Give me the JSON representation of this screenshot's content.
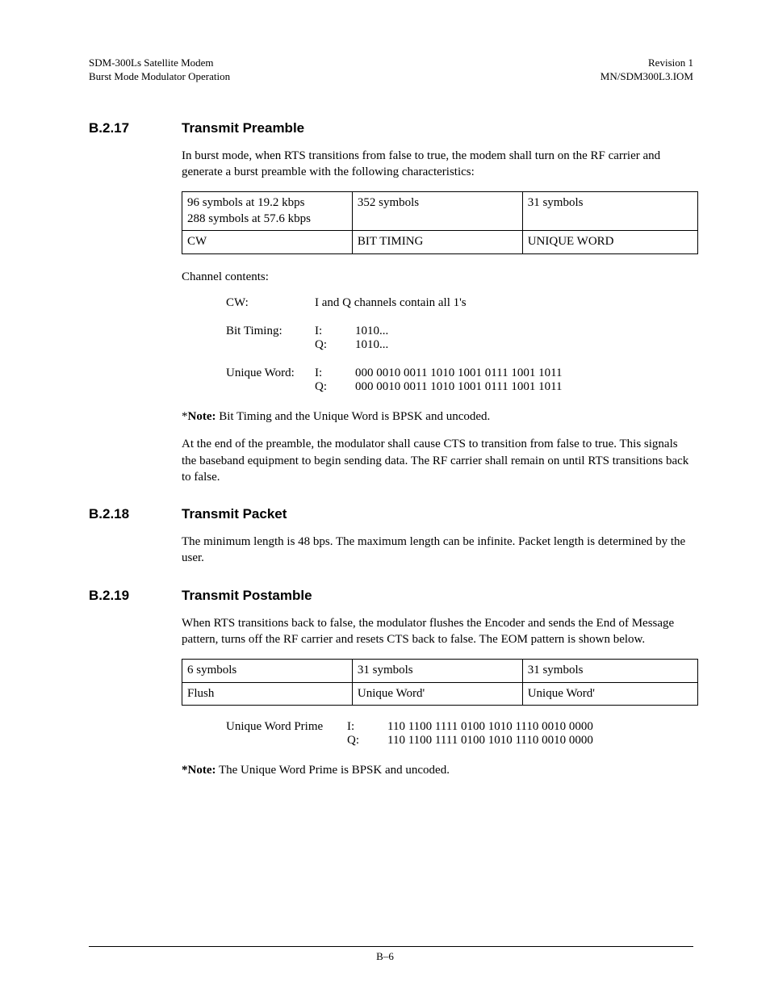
{
  "header": {
    "left": "SDM-300Ls Satellite Modem\nBurst Mode Modulator Operation",
    "right": "Revision 1\nMN/SDM300L3.IOM"
  },
  "s17": {
    "num": "B.2.17",
    "title": "Transmit Preamble",
    "intro": "In burst mode, when RTS transitions from false to true, the modem shall turn on the RF carrier and generate a burst preamble with the following characteristics:",
    "table": {
      "r1c1": "96 symbols at 19.2 kbps\n288 symbols at 57.6 kbps",
      "r1c2": "352 symbols",
      "r1c3": "31 symbols",
      "r2c1": "CW",
      "r2c2": "BIT TIMING",
      "r2c3": "UNIQUE WORD"
    },
    "chcontents_label": "Channel contents:",
    "cw": {
      "label": "CW:",
      "val": "I and Q channels contain all 1's"
    },
    "bt": {
      "label": "Bit Timing:",
      "i_lbl": "I:",
      "q_lbl": "Q:",
      "i_val": "1010...",
      "q_val": "1010..."
    },
    "uw": {
      "label": "Unique Word:",
      "i_lbl": "I:",
      "q_lbl": "Q:",
      "i_val": "000 0010 0011 1010 1001 0111 1001 1011",
      "q_val": "000 0010 0011 1010 1001 0111 1001 1011"
    },
    "note_prefix": "*",
    "note_bold": "Note:",
    "note_text": " Bit Timing and the Unique Word is BPSK and uncoded.",
    "outro": "At the end of the preamble, the modulator shall cause CTS to transition from false to true. This signals the baseband equipment to begin sending data. The RF carrier shall remain on until RTS transitions back to false."
  },
  "s18": {
    "num": "B.2.18",
    "title": "Transmit Packet",
    "body": "The minimum length is 48 bps. The maximum length can be infinite. Packet length is determined by the user."
  },
  "s19": {
    "num": "B.2.19",
    "title": "Transmit Postamble",
    "intro": "When RTS transitions back to false, the modulator flushes the Encoder and sends the End of Message pattern, turns off the RF carrier and resets CTS back to false. The EOM pattern is shown below.",
    "table": {
      "r1c1": "6 symbols",
      "r1c2": "31 symbols",
      "r1c3": "31 symbols",
      "r2c1": "Flush",
      "r2c2": "Unique Word'",
      "r2c3": "Unique Word'"
    },
    "uwp": {
      "label": "Unique Word Prime",
      "i_lbl": "I:",
      "q_lbl": "Q:",
      "i_val": "110 1100 1111 0100 1010 1110 0010 0000",
      "q_val": "110 1100 1111 0100 1010 1110 0010 0000"
    },
    "note_prefix": "*",
    "note_bold": "Note:",
    "note_text": " The Unique Word Prime is BPSK and uncoded."
  },
  "page_number": "B–6"
}
